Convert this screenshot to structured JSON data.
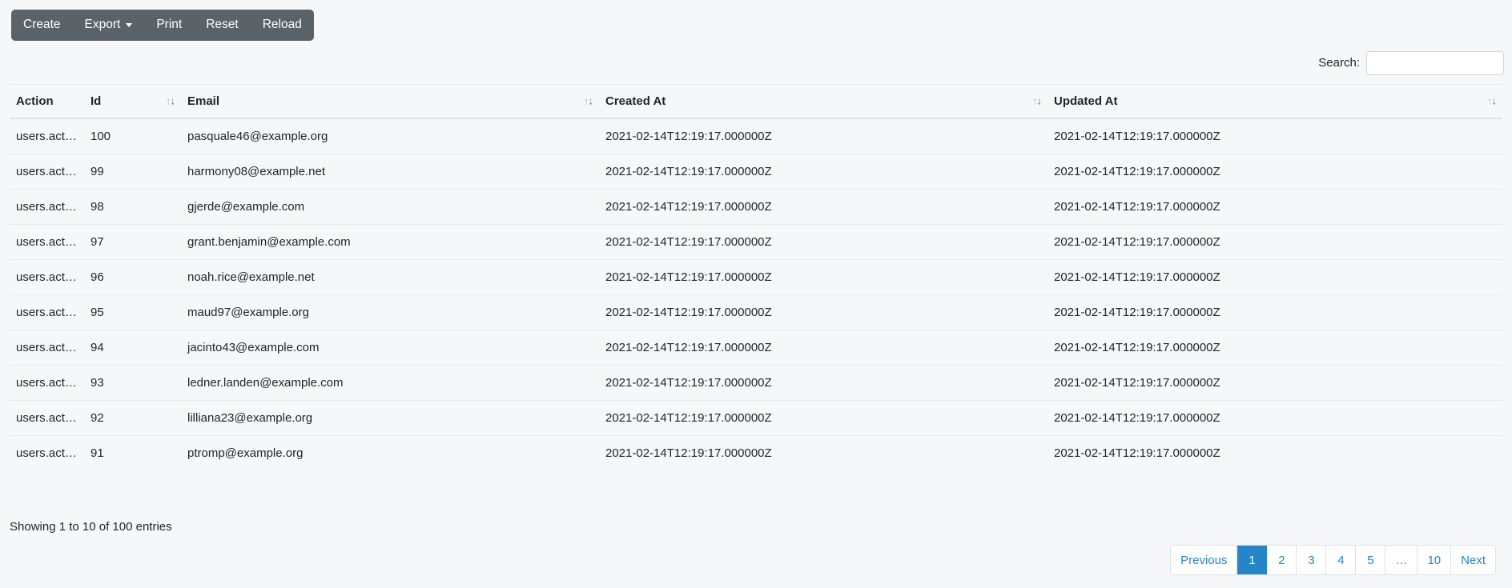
{
  "toolbar": {
    "buttons": [
      {
        "label": "Create",
        "icon": null
      },
      {
        "label": "Export",
        "icon": "chevron-down-icon"
      },
      {
        "label": "Print",
        "icon": null
      },
      {
        "label": "Reset",
        "icon": null
      },
      {
        "label": "Reload",
        "icon": null
      }
    ]
  },
  "search": {
    "label": "Search:",
    "value": "",
    "placeholder": ""
  },
  "table": {
    "columns": [
      {
        "label": "Action",
        "sortable": false,
        "sort_icon": null
      },
      {
        "label": "Id",
        "sortable": true,
        "sort_icon": "sort-both-icon"
      },
      {
        "label": "Email",
        "sortable": true,
        "sort_icon": "sort-both-icon"
      },
      {
        "label": "Created At",
        "sortable": true,
        "sort_icon": "sort-both-icon"
      },
      {
        "label": "Updated At",
        "sortable": true,
        "sort_icon": "sort-both-icon"
      }
    ],
    "rows": [
      {
        "action": "users.action",
        "id": "100",
        "email": "pasquale46@example.org",
        "created_at": "2021-02-14T12:19:17.000000Z",
        "updated_at": "2021-02-14T12:19:17.000000Z"
      },
      {
        "action": "users.action",
        "id": "99",
        "email": "harmony08@example.net",
        "created_at": "2021-02-14T12:19:17.000000Z",
        "updated_at": "2021-02-14T12:19:17.000000Z"
      },
      {
        "action": "users.action",
        "id": "98",
        "email": "gjerde@example.com",
        "created_at": "2021-02-14T12:19:17.000000Z",
        "updated_at": "2021-02-14T12:19:17.000000Z"
      },
      {
        "action": "users.action",
        "id": "97",
        "email": "grant.benjamin@example.com",
        "created_at": "2021-02-14T12:19:17.000000Z",
        "updated_at": "2021-02-14T12:19:17.000000Z"
      },
      {
        "action": "users.action",
        "id": "96",
        "email": "noah.rice@example.net",
        "created_at": "2021-02-14T12:19:17.000000Z",
        "updated_at": "2021-02-14T12:19:17.000000Z"
      },
      {
        "action": "users.action",
        "id": "95",
        "email": "maud97@example.org",
        "created_at": "2021-02-14T12:19:17.000000Z",
        "updated_at": "2021-02-14T12:19:17.000000Z"
      },
      {
        "action": "users.action",
        "id": "94",
        "email": "jacinto43@example.com",
        "created_at": "2021-02-14T12:19:17.000000Z",
        "updated_at": "2021-02-14T12:19:17.000000Z"
      },
      {
        "action": "users.action",
        "id": "93",
        "email": "ledner.landen@example.com",
        "created_at": "2021-02-14T12:19:17.000000Z",
        "updated_at": "2021-02-14T12:19:17.000000Z"
      },
      {
        "action": "users.action",
        "id": "92",
        "email": "lilliana23@example.org",
        "created_at": "2021-02-14T12:19:17.000000Z",
        "updated_at": "2021-02-14T12:19:17.000000Z"
      },
      {
        "action": "users.action",
        "id": "91",
        "email": "ptromp@example.org",
        "created_at": "2021-02-14T12:19:17.000000Z",
        "updated_at": "2021-02-14T12:19:17.000000Z"
      }
    ]
  },
  "footer": {
    "info": "Showing 1 to 10 of 100 entries",
    "pagination": [
      {
        "label": "Previous",
        "active": false,
        "kind": "prev"
      },
      {
        "label": "1",
        "active": true,
        "kind": "page"
      },
      {
        "label": "2",
        "active": false,
        "kind": "page"
      },
      {
        "label": "3",
        "active": false,
        "kind": "page"
      },
      {
        "label": "4",
        "active": false,
        "kind": "page"
      },
      {
        "label": "5",
        "active": false,
        "kind": "page"
      },
      {
        "label": "…",
        "active": false,
        "kind": "ellipsis"
      },
      {
        "label": "10",
        "active": false,
        "kind": "page"
      },
      {
        "label": "Next",
        "active": false,
        "kind": "next"
      }
    ]
  },
  "colors": {
    "toolbar_bg": "#5b6368",
    "accent": "#2684c8",
    "page_bg": "#f6f7f9",
    "border": "#dee2e6"
  }
}
